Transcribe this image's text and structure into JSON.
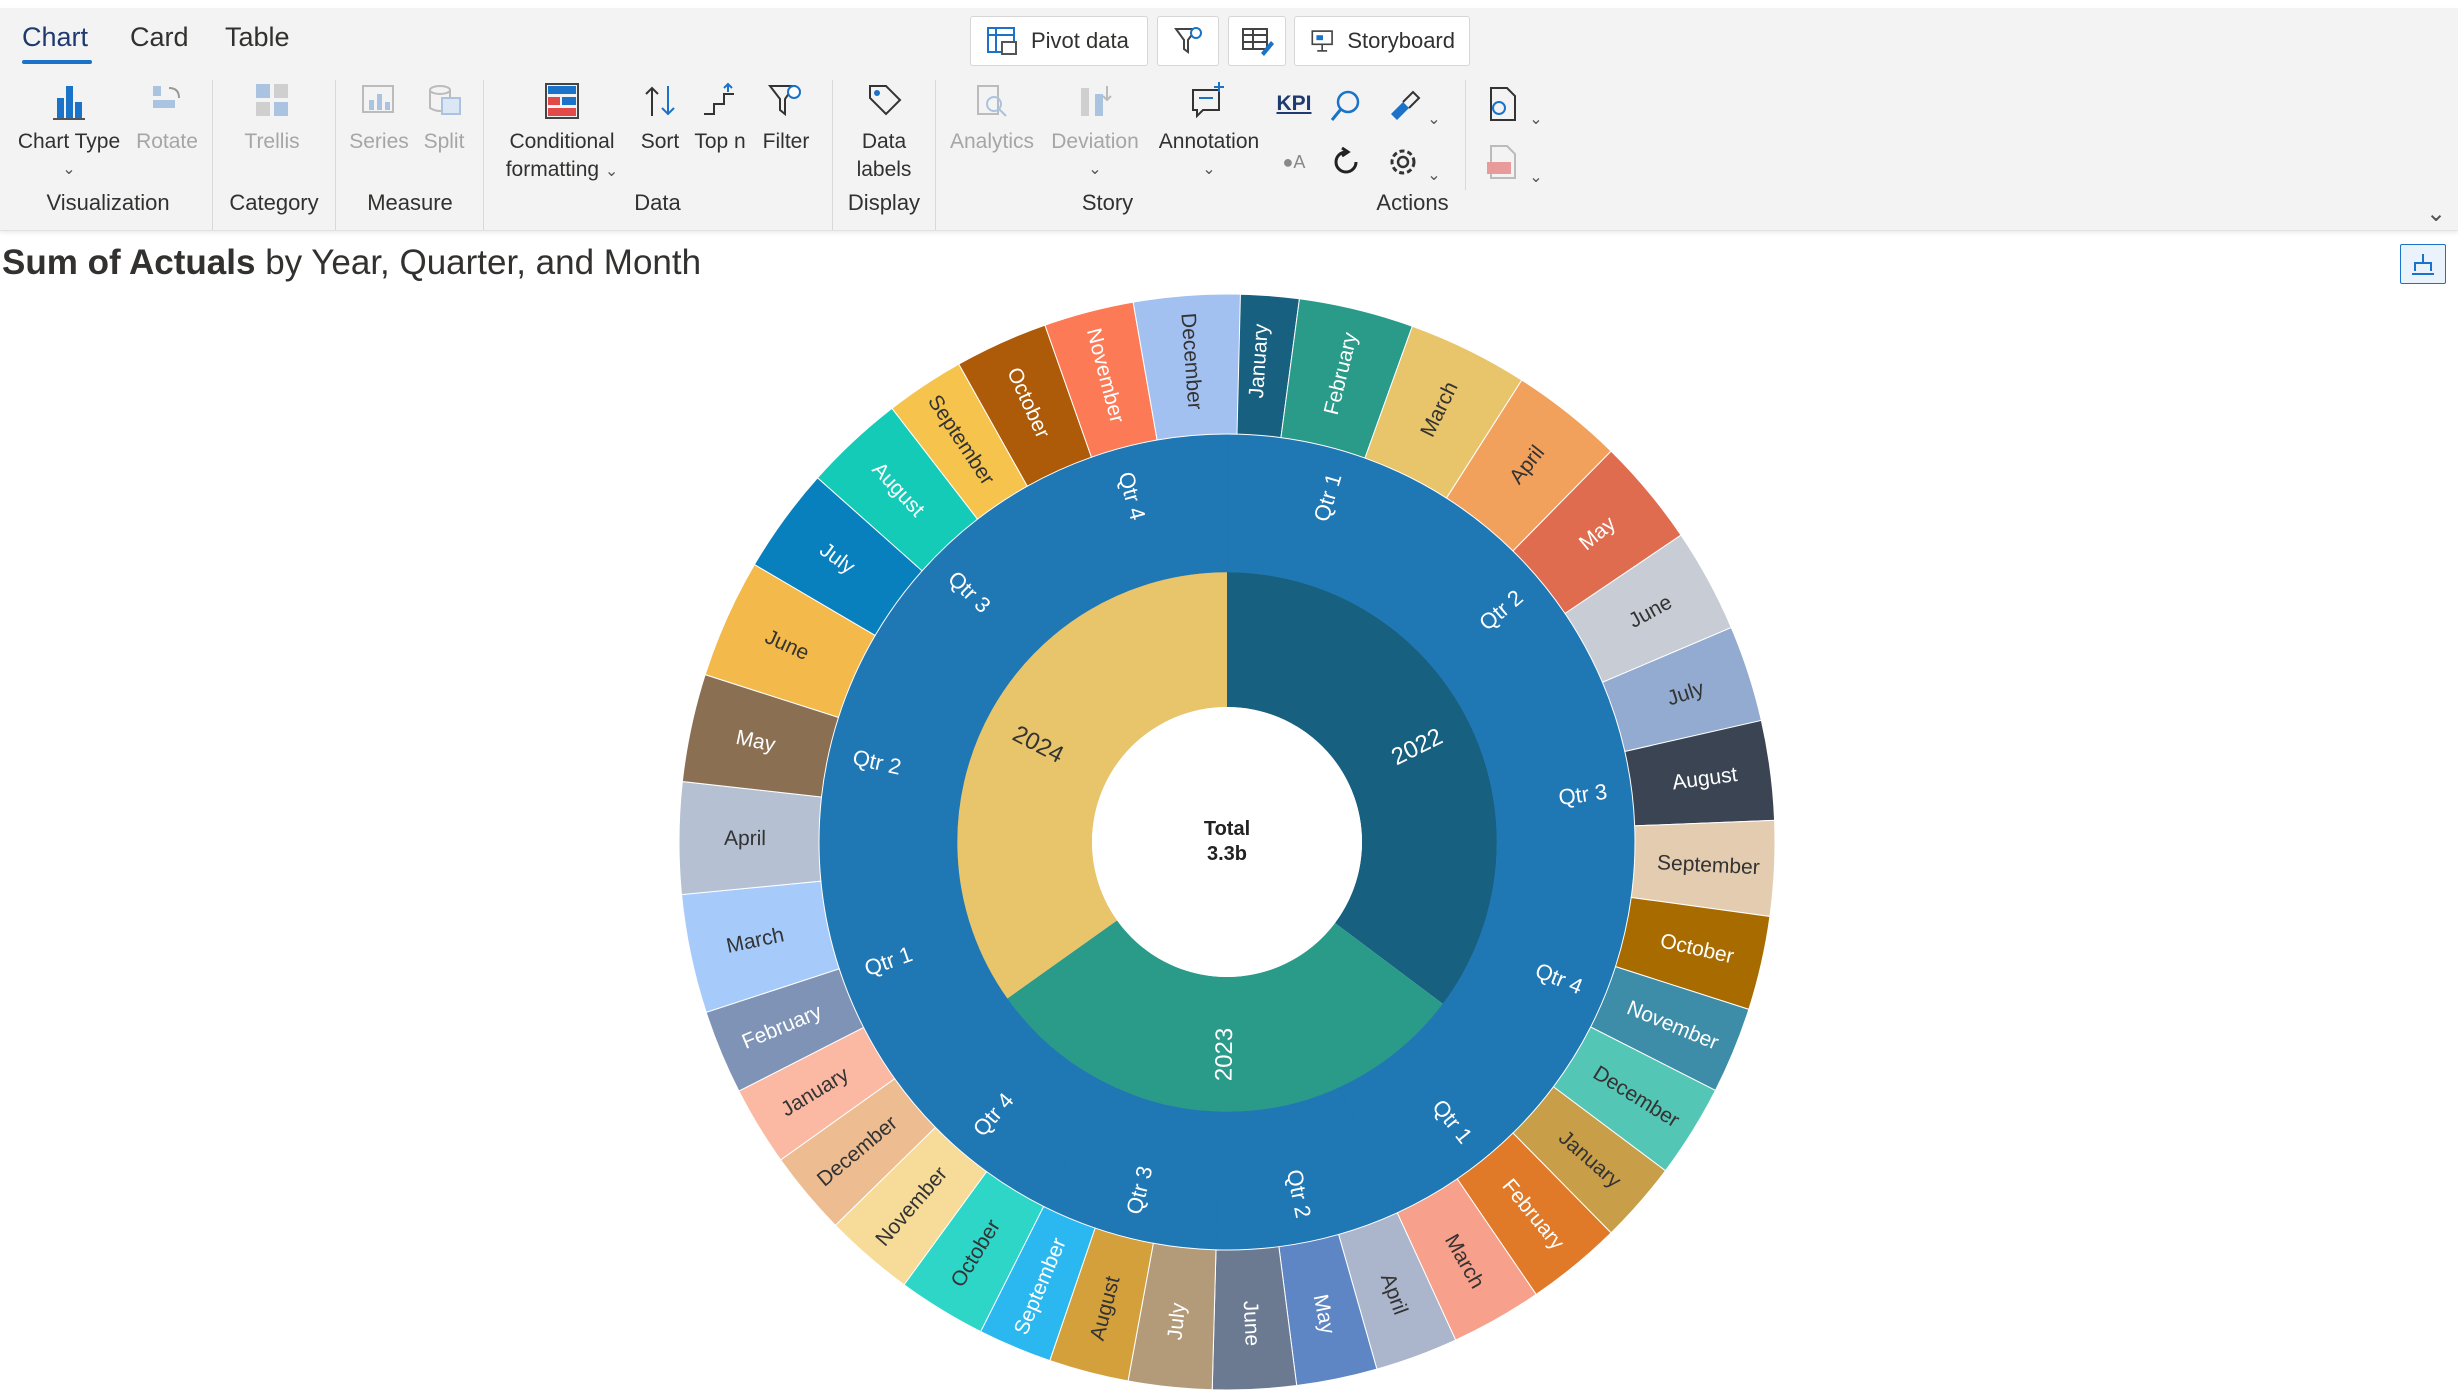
{
  "tabs": [
    {
      "label": "Chart",
      "active": true
    },
    {
      "label": "Card",
      "active": false
    },
    {
      "label": "Table",
      "active": false
    }
  ],
  "top_buttons": {
    "pivot_label": "Pivot data",
    "storyboard_label": "Storyboard"
  },
  "ribbon": {
    "chart_type": "Chart Type",
    "rotate": "Rotate",
    "trellis": "Trellis",
    "series": "Series",
    "split": "Split",
    "conditional_formatting_line1": "Conditional",
    "conditional_formatting_line2": "formatting",
    "sort": "Sort",
    "top_n": "Top n",
    "filter": "Filter",
    "data_labels_line1": "Data",
    "data_labels_line2": "labels",
    "analytics": "Analytics",
    "deviation": "Deviation",
    "annotation": "Annotation",
    "kpi": "KPI",
    "groups": {
      "visualization": "Visualization",
      "category": "Category",
      "measure": "Measure",
      "data": "Data",
      "display": "Display",
      "story": "Story",
      "actions": "Actions"
    }
  },
  "title": {
    "measure": "Sum of Actuals",
    "rest": "by Year, Quarter, and Month"
  },
  "colors": {
    "accent": "#1a73c9",
    "quarter_ring": "#1f77b4"
  },
  "chart_data": {
    "type": "sunburst",
    "center_label": "Total",
    "center_value": "3.3b",
    "years": [
      {
        "label": "2022",
        "color": "#17607f",
        "share": 0.3524
      },
      {
        "label": "2023",
        "color": "#2a9a89",
        "share": 0.2991
      },
      {
        "label": "2024",
        "color": "#e8c46a",
        "share": 0.3485
      }
    ],
    "quarters": [
      {
        "year": "2022",
        "label": "Qtr 1",
        "share": 0.0904
      },
      {
        "year": "2022",
        "label": "Qtr 2",
        "share": 0.0956
      },
      {
        "year": "2022",
        "label": "Qtr 3",
        "share": 0.0857
      },
      {
        "year": "2022",
        "label": "Qtr 4",
        "share": 0.0807
      },
      {
        "year": "2023",
        "label": "Qtr 1",
        "share": 0.0791
      },
      {
        "year": "2023",
        "label": "Qtr 2",
        "share": 0.0728
      },
      {
        "year": "2023",
        "label": "Qtr 3",
        "share": 0.0699
      },
      {
        "year": "2023",
        "label": "Qtr 4",
        "share": 0.0773
      },
      {
        "year": "2024",
        "label": "Qtr 1",
        "share": 0.0893
      },
      {
        "year": "2024",
        "label": "Qtr 2",
        "share": 0.0898
      },
      {
        "year": "2024",
        "label": "Qtr 3",
        "share": 0.0841
      },
      {
        "year": "2024",
        "label": "Qtr 4",
        "share": 0.0853
      }
    ],
    "months": [
      {
        "label": "January",
        "color": "#17607f",
        "share": 0.0211
      },
      {
        "label": "February",
        "color": "#2a9a89",
        "share": 0.0338
      },
      {
        "label": "March",
        "color": "#e8c46a",
        "share": 0.0355
      },
      {
        "label": "April",
        "color": "#f2a15d",
        "share": 0.0332
      },
      {
        "label": "May",
        "color": "#e06c4f",
        "share": 0.0318
      },
      {
        "label": "June",
        "color": "#c8ccd4",
        "share": 0.0306
      },
      {
        "label": "July",
        "color": "#93abd0",
        "share": 0.0284
      },
      {
        "label": "August",
        "color": "#3a4452",
        "share": 0.0293
      },
      {
        "label": "September",
        "color": "#e3ccaf",
        "share": 0.028
      },
      {
        "label": "October",
        "color": "#a86b00",
        "share": 0.0277
      },
      {
        "label": "November",
        "color": "#3d8ca8",
        "share": 0.0255
      },
      {
        "label": "December",
        "color": "#54c6b6",
        "share": 0.0275
      },
      {
        "label": "January",
        "color": "#c89f48",
        "share": 0.024
      },
      {
        "label": "February",
        "color": "#e07a28",
        "share": 0.0282
      },
      {
        "label": "March",
        "color": "#f7a08b",
        "share": 0.0269
      },
      {
        "label": "April",
        "color": "#abb5cc",
        "share": 0.0244
      },
      {
        "label": "May",
        "color": "#5e86c4",
        "share": 0.0238
      },
      {
        "label": "June",
        "color": "#6b7a91",
        "share": 0.0246
      },
      {
        "label": "July",
        "color": "#b39a79",
        "share": 0.0246
      },
      {
        "label": "August",
        "color": "#d4a03c",
        "share": 0.0235
      },
      {
        "label": "September",
        "color": "#2bb8f0",
        "share": 0.0218
      },
      {
        "label": "October",
        "color": "#2ed6c8",
        "share": 0.0261
      },
      {
        "label": "November",
        "color": "#f6dc98",
        "share": 0.0264
      },
      {
        "label": "December",
        "color": "#edbc91",
        "share": 0.0248
      },
      {
        "label": "January",
        "color": "#fbb8a3",
        "share": 0.0234
      },
      {
        "label": "February",
        "color": "#7e93b5",
        "share": 0.0248
      },
      {
        "label": "March",
        "color": "#a6cbfa",
        "share": 0.035
      },
      {
        "label": "April",
        "color": "#b5c0d2",
        "share": 0.0329
      },
      {
        "label": "May",
        "color": "#8a6f52",
        "share": 0.0318
      },
      {
        "label": "June",
        "color": "#f3b94a",
        "share": 0.0351
      },
      {
        "label": "July",
        "color": "#0980be",
        "share": 0.0312
      },
      {
        "label": "August",
        "color": "#14cbb8",
        "share": 0.0296
      },
      {
        "label": "September",
        "color": "#f6c44c",
        "share": 0.0233
      },
      {
        "label": "October",
        "color": "#ad5a09",
        "share": 0.0275
      },
      {
        "label": "November",
        "color": "#fd7a56",
        "share": 0.0265
      },
      {
        "label": "December",
        "color": "#a2c0f0",
        "share": 0.0313
      }
    ]
  }
}
